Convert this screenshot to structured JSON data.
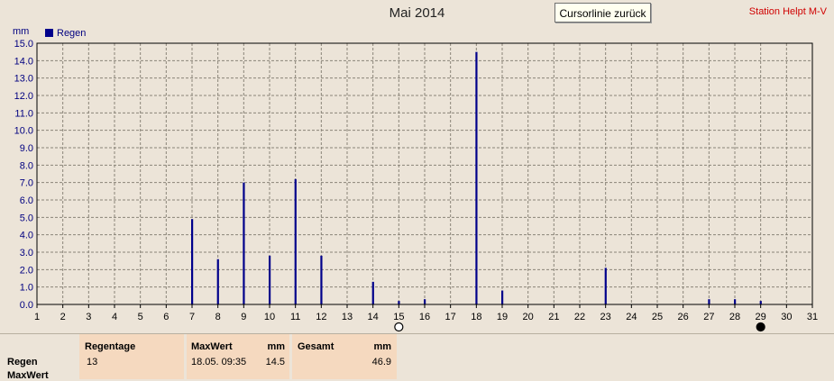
{
  "window": {
    "cursor_button_label": "Cursorlinie zurück",
    "station": "Station Helpt M-V"
  },
  "chart_data": {
    "type": "bar",
    "title": "Mai 2014",
    "ylabel": "mm",
    "xlabel": "",
    "legend": {
      "position": "top-left",
      "entries": [
        "Regen"
      ]
    },
    "grid": true,
    "xlim": [
      1,
      31
    ],
    "ylim": [
      0,
      15
    ],
    "x_ticks": [
      1,
      2,
      3,
      4,
      5,
      6,
      7,
      8,
      9,
      10,
      11,
      12,
      13,
      14,
      15,
      16,
      17,
      18,
      19,
      20,
      21,
      22,
      23,
      24,
      25,
      26,
      27,
      28,
      29,
      30,
      31
    ],
    "y_ticks": [
      "0.0",
      "1.0",
      "2.0",
      "3.0",
      "4.0",
      "5.0",
      "6.0",
      "7.0",
      "8.0",
      "9.0",
      "10.0",
      "11.0",
      "12.0",
      "13.0",
      "14.0",
      "15.0"
    ],
    "series": [
      {
        "name": "Regen",
        "color": "#00008b",
        "points": [
          {
            "x": 7,
            "y": 4.9
          },
          {
            "x": 8,
            "y": 2.6
          },
          {
            "x": 9,
            "y": 7.0
          },
          {
            "x": 10,
            "y": 2.8
          },
          {
            "x": 11,
            "y": 7.2
          },
          {
            "x": 12,
            "y": 2.8
          },
          {
            "x": 14,
            "y": 1.3
          },
          {
            "x": 15,
            "y": 0.2
          },
          {
            "x": 16,
            "y": 0.3
          },
          {
            "x": 18,
            "y": 14.5
          },
          {
            "x": 19,
            "y": 0.8
          },
          {
            "x": 23,
            "y": 2.1
          },
          {
            "x": 27,
            "y": 0.3
          },
          {
            "x": 28,
            "y": 0.3
          },
          {
            "x": 29,
            "y": 0.2
          }
        ]
      }
    ],
    "markers": [
      {
        "x": 15,
        "style": "open-circle"
      },
      {
        "x": 29,
        "style": "filled-circle"
      }
    ]
  },
  "summary": {
    "row_labels": [
      "Regen",
      "MaxWert"
    ],
    "regentage": {
      "header": "Regentage",
      "value": "13"
    },
    "maxwert": {
      "header": "MaxWert",
      "unit": "mm",
      "time": "18.05.  09:35",
      "value": "14.5"
    },
    "gesamt": {
      "header": "Gesamt",
      "unit": "mm",
      "value": "46.9"
    }
  }
}
